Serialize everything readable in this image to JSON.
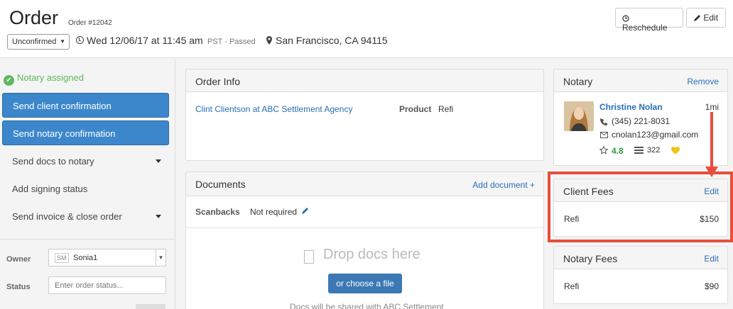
{
  "header": {
    "title": "Order",
    "order_number": "Order #12042",
    "status_select": "Unconfirmed",
    "datetime": "Wed 12/06/17 at 11:45 am",
    "timezone_note": "PST - Passed",
    "location": "San Francisco, CA 94115",
    "reschedule_label": "Reschedule",
    "edit_label": "Edit"
  },
  "sidebar": {
    "assigned_status": "Notary assigned",
    "send_client_confirmation": "Send client confirmation",
    "send_notary_confirmation": "Send notary confirmation",
    "items": [
      {
        "label": "Send docs to notary"
      },
      {
        "label": "Add signing status"
      },
      {
        "label": "Send invoice & close order"
      }
    ],
    "owner_label": "Owner",
    "owner_badge": "SM",
    "owner_value": "Sonia1",
    "status_label": "Status",
    "status_placeholder": "Enter order status..."
  },
  "order_info": {
    "title": "Order Info",
    "client_link": "Clint Clientson at ABC Settlement Agency",
    "product_label": "Product",
    "product_value": "Refi"
  },
  "documents": {
    "title": "Documents",
    "add_link": "Add document +",
    "scanbacks_label": "Scanbacks",
    "scanbacks_value": "Not required",
    "drop_text": "Drop docs here",
    "choose_label": "or choose a file",
    "share_note": "Docs will be shared with ABC Settlement"
  },
  "notary": {
    "title": "Notary",
    "remove_label": "Remove",
    "name": "Christine Nolan",
    "distance": "1mi",
    "phone": "(345) 221-8031",
    "email": "cnolan123@gmail.com",
    "rating": "4.8",
    "jobs": "322"
  },
  "client_fees": {
    "title": "Client Fees",
    "edit_label": "Edit",
    "item": "Refi",
    "amount": "$150"
  },
  "notary_fees": {
    "title": "Notary Fees",
    "edit_label": "Edit",
    "item": "Refi",
    "amount": "$90"
  },
  "colors": {
    "primary_button": "#3c87cb",
    "link": "#2a6eb7",
    "success": "#5cb85c",
    "annotation": "#e84e3c",
    "star_rating": "#2e9b3e"
  }
}
